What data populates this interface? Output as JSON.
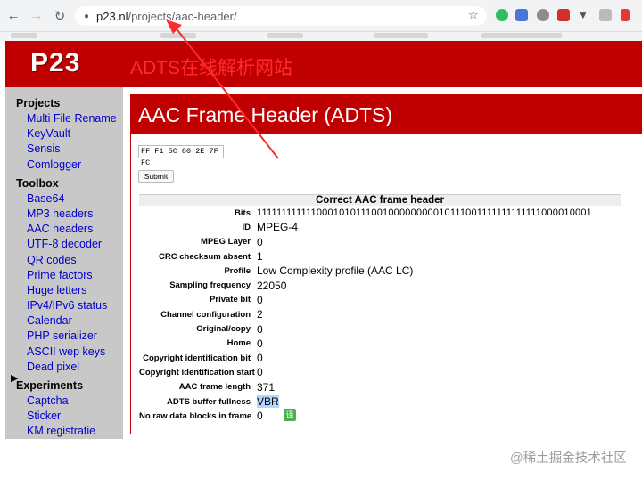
{
  "browser": {
    "url_host": "p23.nl",
    "url_path": "/projects/aac-header/"
  },
  "site": {
    "logo": "P23"
  },
  "sidebar": {
    "sections": [
      {
        "heading": "Projects",
        "items": [
          "Multi File Rename",
          "KeyVault",
          "Sensis",
          "Comlogger"
        ]
      },
      {
        "heading": "Toolbox",
        "items": [
          "Base64",
          "MP3 headers",
          "AAC headers",
          "UTF-8 decoder",
          "QR codes",
          "Prime factors",
          "Huge letters",
          "IPv4/IPv6 status",
          "Calendar",
          "PHP serializer",
          "ASCII wep keys",
          "Dead pixel"
        ]
      },
      {
        "heading": "Experiments",
        "items": [
          "Captcha",
          "Sticker",
          "KM registratie"
        ]
      }
    ]
  },
  "main": {
    "title": "AAC Frame Header (ADTS)",
    "hex_input": "FF F1 5C 80 2E 7F FC",
    "submit_label": "Submit",
    "annotation": "ADTS在线解析网站",
    "table_header": "Correct AAC frame header",
    "rows": [
      {
        "label": "Bits",
        "value": "111111111111000101011100100000000010111001111111111111000010001"
      },
      {
        "label": "ID",
        "value": "MPEG-4"
      },
      {
        "label": "MPEG Layer",
        "value": "0"
      },
      {
        "label": "CRC checksum absent",
        "value": "1"
      },
      {
        "label": "Profile",
        "value": "Low Complexity profile (AAC LC)"
      },
      {
        "label": "Sampling frequency",
        "value": "22050"
      },
      {
        "label": "Private bit",
        "value": "0"
      },
      {
        "label": "Channel configuration",
        "value": "2"
      },
      {
        "label": "Original/copy",
        "value": "0"
      },
      {
        "label": "Home",
        "value": "0"
      },
      {
        "label": "Copyright identification bit",
        "value": "0"
      },
      {
        "label": "Copyright identification start",
        "value": "0"
      },
      {
        "label": "AAC frame length",
        "value": "371"
      },
      {
        "label": "ADTS buffer fullness",
        "value": "VBR"
      },
      {
        "label": "No raw data blocks in frame",
        "value": "0"
      }
    ],
    "translate_badge": "译"
  },
  "watermark": "@稀土掘金技术社区",
  "colors": {
    "brand_red": "#c00000",
    "link_blue": "#0000cc",
    "annotation_red": "#ff2a2a"
  }
}
